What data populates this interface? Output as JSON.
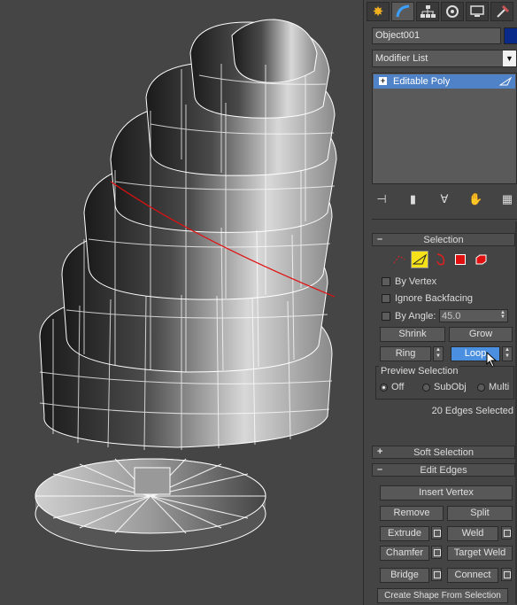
{
  "command_panel": {
    "tabs": [
      "create-tab",
      "modify-tab",
      "hierarchy-tab",
      "motion-tab",
      "display-tab",
      "utilities-tab"
    ],
    "object_name": "Object001",
    "object_color": "#0a2a8a",
    "modifier_list": "Modifier List",
    "stack": [
      {
        "label": "Editable Poly",
        "expand": "+"
      }
    ],
    "accent_color": "#4f82c6"
  },
  "selection": {
    "title": "Selection",
    "collapse": "–",
    "by_vertex": "By Vertex",
    "ignore_backfacing": "Ignore Backfacing",
    "by_angle": "By Angle:",
    "angle_value": "45.0",
    "shrink": "Shrink",
    "grow": "Grow",
    "ring": "Ring",
    "loop": "Loop",
    "preview_title": "Preview Selection",
    "preview_off": "Off",
    "preview_subobj": "SubObj",
    "preview_multi": "Multi",
    "status": "20 Edges Selected"
  },
  "soft_selection": {
    "title": "Soft Selection",
    "expand": "+"
  },
  "edit_edges": {
    "title": "Edit Edges",
    "collapse": "–",
    "insert_vertex": "Insert Vertex",
    "remove": "Remove",
    "split": "Split",
    "extrude": "Extrude",
    "weld": "Weld",
    "chamfer": "Chamfer",
    "target_weld": "Target Weld",
    "bridge": "Bridge",
    "connect": "Connect",
    "create_shape": "Create Shape From Selection"
  }
}
